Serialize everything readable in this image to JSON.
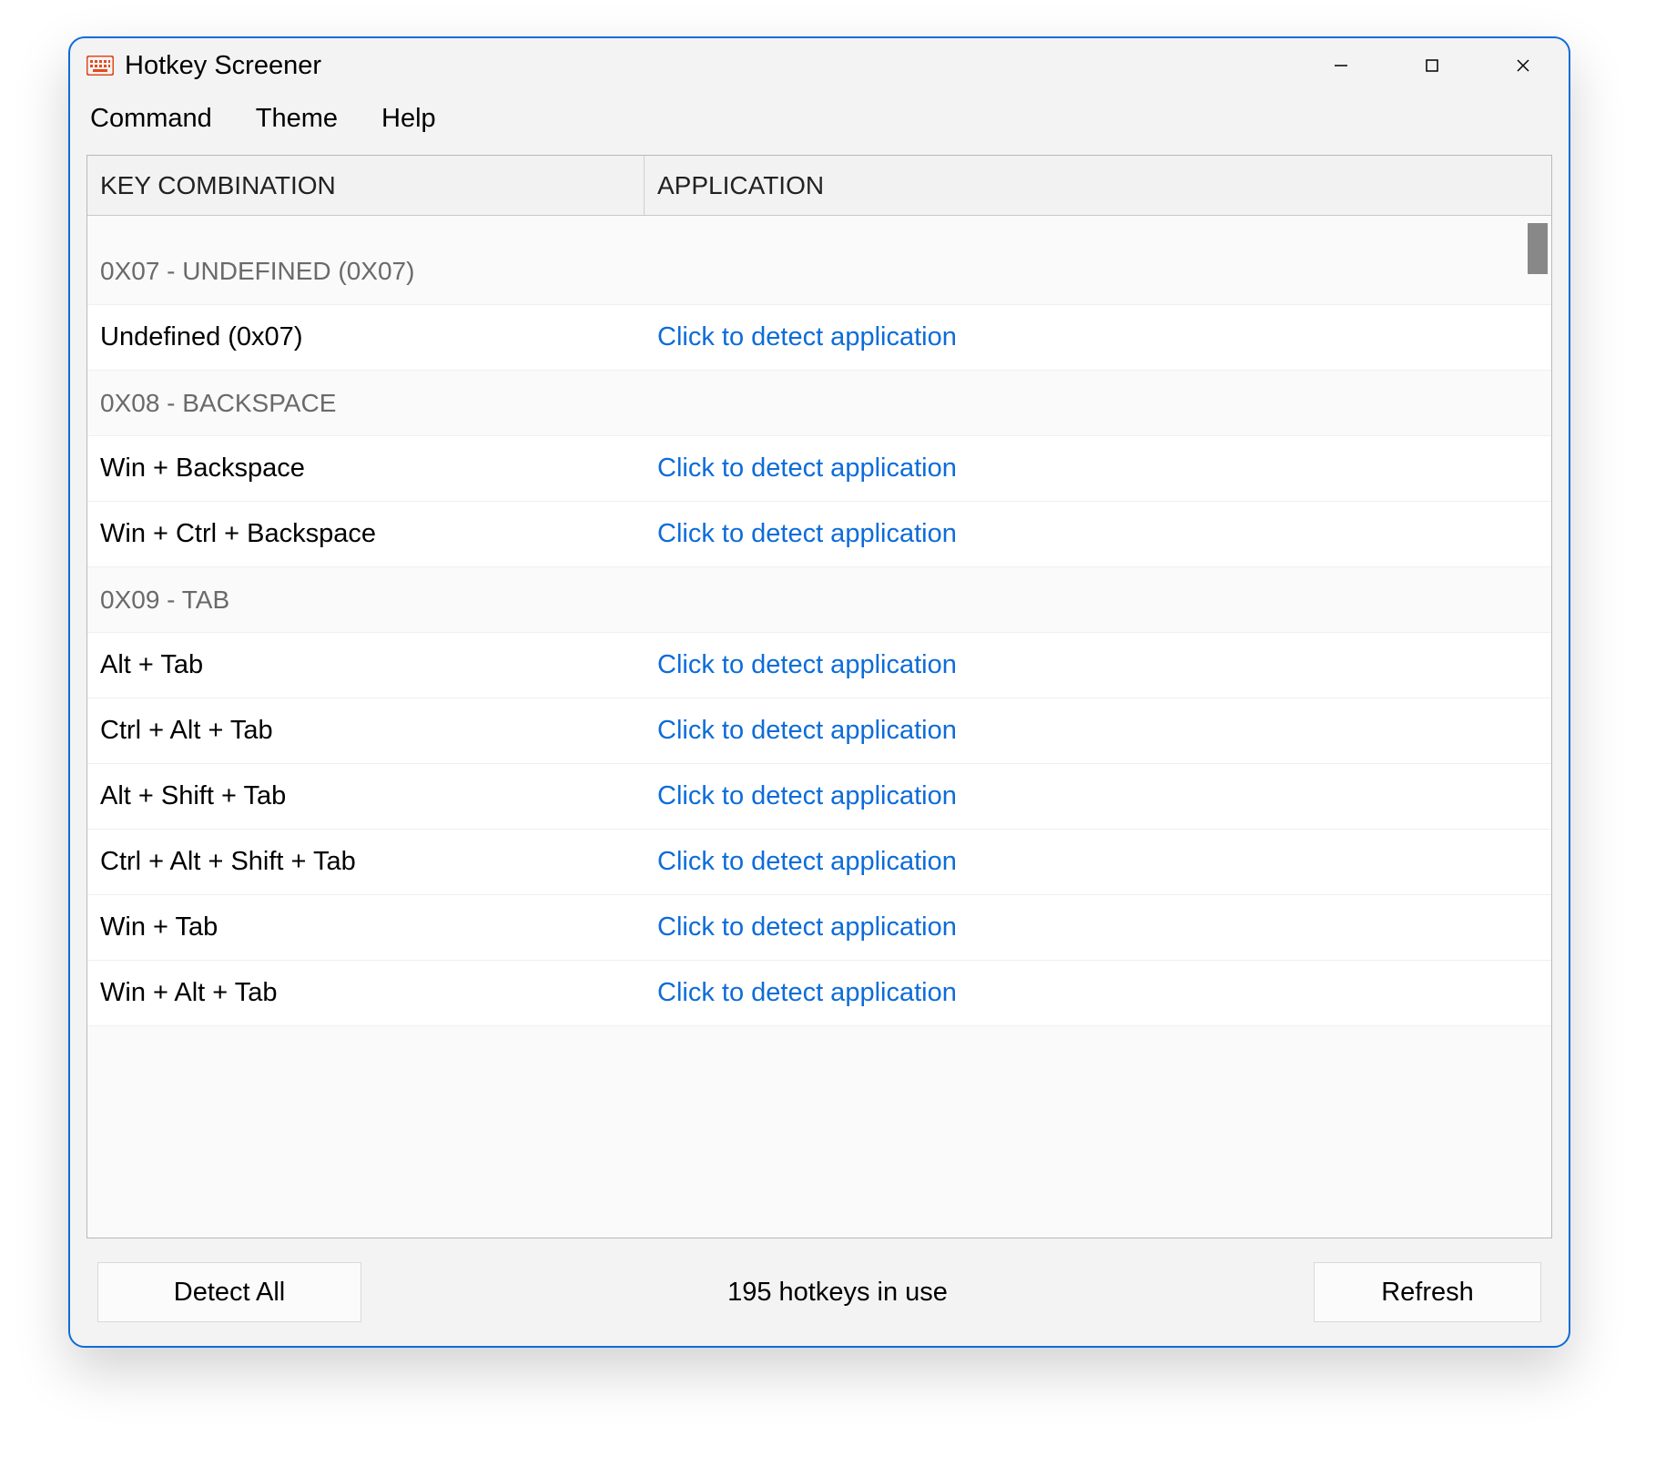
{
  "window": {
    "title": "Hotkey Screener"
  },
  "menu": {
    "items": [
      "Command",
      "Theme",
      "Help"
    ]
  },
  "columns": {
    "key": "KEY COMBINATION",
    "app": "APPLICATION"
  },
  "detect_link_label": "Click to detect application",
  "groups": [
    {
      "title": "0X07 - UNDEFINED (0X07)",
      "rows": [
        {
          "key": "Undefined (0x07)"
        }
      ]
    },
    {
      "title": "0X08 - BACKSPACE",
      "rows": [
        {
          "key": "Win + Backspace"
        },
        {
          "key": "Win + Ctrl + Backspace"
        }
      ]
    },
    {
      "title": "0X09 - TAB",
      "rows": [
        {
          "key": "Alt + Tab"
        },
        {
          "key": "Ctrl + Alt + Tab"
        },
        {
          "key": "Alt + Shift + Tab"
        },
        {
          "key": "Ctrl + Alt + Shift + Tab"
        },
        {
          "key": "Win + Tab"
        },
        {
          "key": "Win + Alt + Tab"
        }
      ]
    }
  ],
  "buttons": {
    "detect_all": "Detect All",
    "refresh": "Refresh"
  },
  "status": {
    "text": "195 hotkeys in use"
  },
  "colors": {
    "accent": "#0d6cd8",
    "icon": "#e24a1e"
  }
}
